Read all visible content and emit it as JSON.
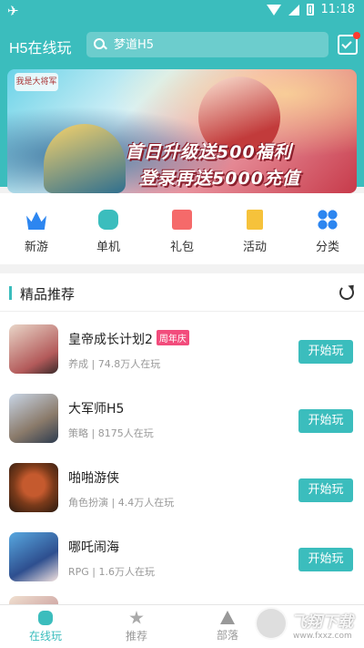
{
  "status_bar": {
    "time": "11:18"
  },
  "header": {
    "title": "H5在线玩",
    "search_placeholder": "梦道H5"
  },
  "banner": {
    "logo_text": "我是大将军",
    "line1": "首日升级送500福利",
    "line2": "登录再送5000充值"
  },
  "categories": [
    {
      "label": "新游",
      "icon": "crown-icon"
    },
    {
      "label": "单机",
      "icon": "gamepad-icon"
    },
    {
      "label": "礼包",
      "icon": "gift-icon"
    },
    {
      "label": "活动",
      "icon": "flag-icon"
    },
    {
      "label": "分类",
      "icon": "grid-icon"
    }
  ],
  "section": {
    "title": "精品推荐"
  },
  "games": [
    {
      "name": "皇帝成长计划2",
      "tag": "周年庆",
      "meta": "养成 | 74.8万人在玩",
      "button": "开始玩"
    },
    {
      "name": "大军师H5",
      "tag": "",
      "meta": "策略 | 8175人在玩",
      "button": "开始玩"
    },
    {
      "name": "啪啪游侠",
      "tag": "",
      "meta": "角色扮演 | 4.4万人在玩",
      "button": "开始玩"
    },
    {
      "name": "哪吒闹海",
      "tag": "",
      "meta": "RPG | 1.6万人在玩",
      "button": "开始玩"
    }
  ],
  "tabs": [
    {
      "label": "在线玩",
      "active": true
    },
    {
      "label": "推荐",
      "active": false
    },
    {
      "label": "部落",
      "active": false
    }
  ],
  "watermark": {
    "line1": "飞翔下载",
    "line2": "www.fxxz.com"
  },
  "colors": {
    "accent": "#3bbdbd",
    "tag": "#f24c7c"
  }
}
